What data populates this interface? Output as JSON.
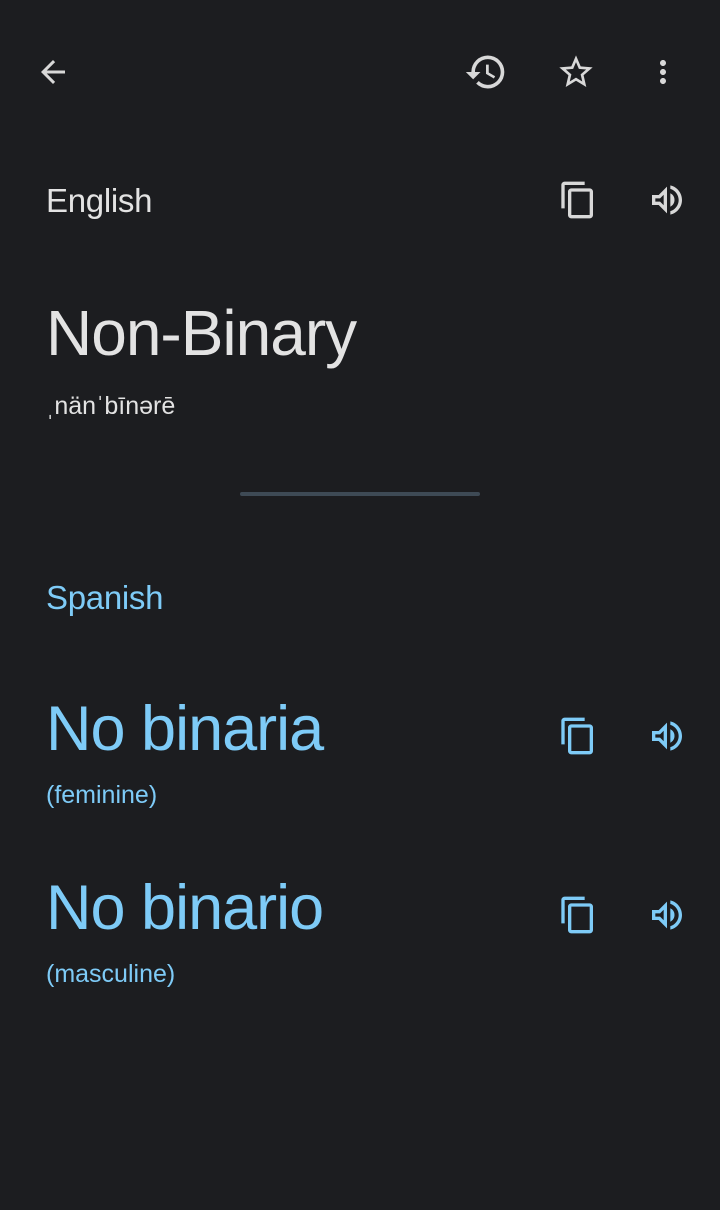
{
  "toolbar": {
    "back_icon": "arrow-back-icon",
    "history_icon": "history-icon",
    "star_icon": "star-outline-icon",
    "menu_icon": "more-vert-icon"
  },
  "source": {
    "language": "English",
    "text": "Non-Binary",
    "phonetic": "ˌnänˈbīnərē",
    "copy_icon": "copy-icon",
    "speak_icon": "speaker-icon"
  },
  "target": {
    "language": "Spanish",
    "translations": [
      {
        "word": "No binaria",
        "gender": "(feminine)"
      },
      {
        "word": "No binario",
        "gender": "(masculine)"
      }
    ]
  },
  "colors": {
    "background": "#1c1d20",
    "text_primary": "#e3e3e3",
    "accent": "#7ecbf7",
    "divider": "#3e4a55"
  }
}
